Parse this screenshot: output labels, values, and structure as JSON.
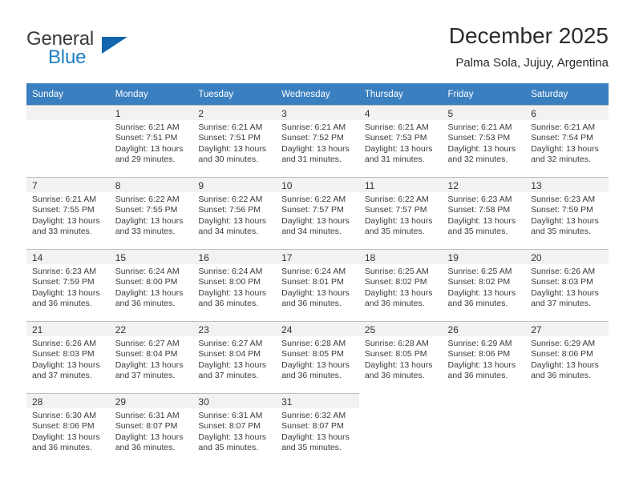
{
  "logo": {
    "word_one": "General",
    "word_two": "Blue",
    "triangle_icon": "triangle-icon",
    "color_blue": "#1d7fc4",
    "color_triangle": "#1266ad"
  },
  "header": {
    "title": "December 2025",
    "subtitle": "Palma Sola, Jujuy, Argentina"
  },
  "calendar": {
    "header_bg": "#3a7fbf",
    "daynum_bg": "#f2f2f2",
    "weekdays": [
      "Sunday",
      "Monday",
      "Tuesday",
      "Wednesday",
      "Thursday",
      "Friday",
      "Saturday"
    ],
    "weeks": [
      [
        {
          "day": "",
          "sunrise": "",
          "sunset": "",
          "daylight_line1": "",
          "daylight_line2": "",
          "empty": true
        },
        {
          "day": "1",
          "sunrise": "Sunrise: 6:21 AM",
          "sunset": "Sunset: 7:51 PM",
          "daylight_line1": "Daylight: 13 hours",
          "daylight_line2": "and 29 minutes."
        },
        {
          "day": "2",
          "sunrise": "Sunrise: 6:21 AM",
          "sunset": "Sunset: 7:51 PM",
          "daylight_line1": "Daylight: 13 hours",
          "daylight_line2": "and 30 minutes."
        },
        {
          "day": "3",
          "sunrise": "Sunrise: 6:21 AM",
          "sunset": "Sunset: 7:52 PM",
          "daylight_line1": "Daylight: 13 hours",
          "daylight_line2": "and 31 minutes."
        },
        {
          "day": "4",
          "sunrise": "Sunrise: 6:21 AM",
          "sunset": "Sunset: 7:53 PM",
          "daylight_line1": "Daylight: 13 hours",
          "daylight_line2": "and 31 minutes."
        },
        {
          "day": "5",
          "sunrise": "Sunrise: 6:21 AM",
          "sunset": "Sunset: 7:53 PM",
          "daylight_line1": "Daylight: 13 hours",
          "daylight_line2": "and 32 minutes."
        },
        {
          "day": "6",
          "sunrise": "Sunrise: 6:21 AM",
          "sunset": "Sunset: 7:54 PM",
          "daylight_line1": "Daylight: 13 hours",
          "daylight_line2": "and 32 minutes."
        }
      ],
      [
        {
          "day": "7",
          "sunrise": "Sunrise: 6:21 AM",
          "sunset": "Sunset: 7:55 PM",
          "daylight_line1": "Daylight: 13 hours",
          "daylight_line2": "and 33 minutes."
        },
        {
          "day": "8",
          "sunrise": "Sunrise: 6:22 AM",
          "sunset": "Sunset: 7:55 PM",
          "daylight_line1": "Daylight: 13 hours",
          "daylight_line2": "and 33 minutes."
        },
        {
          "day": "9",
          "sunrise": "Sunrise: 6:22 AM",
          "sunset": "Sunset: 7:56 PM",
          "daylight_line1": "Daylight: 13 hours",
          "daylight_line2": "and 34 minutes."
        },
        {
          "day": "10",
          "sunrise": "Sunrise: 6:22 AM",
          "sunset": "Sunset: 7:57 PM",
          "daylight_line1": "Daylight: 13 hours",
          "daylight_line2": "and 34 minutes."
        },
        {
          "day": "11",
          "sunrise": "Sunrise: 6:22 AM",
          "sunset": "Sunset: 7:57 PM",
          "daylight_line1": "Daylight: 13 hours",
          "daylight_line2": "and 35 minutes."
        },
        {
          "day": "12",
          "sunrise": "Sunrise: 6:23 AM",
          "sunset": "Sunset: 7:58 PM",
          "daylight_line1": "Daylight: 13 hours",
          "daylight_line2": "and 35 minutes."
        },
        {
          "day": "13",
          "sunrise": "Sunrise: 6:23 AM",
          "sunset": "Sunset: 7:59 PM",
          "daylight_line1": "Daylight: 13 hours",
          "daylight_line2": "and 35 minutes."
        }
      ],
      [
        {
          "day": "14",
          "sunrise": "Sunrise: 6:23 AM",
          "sunset": "Sunset: 7:59 PM",
          "daylight_line1": "Daylight: 13 hours",
          "daylight_line2": "and 36 minutes."
        },
        {
          "day": "15",
          "sunrise": "Sunrise: 6:24 AM",
          "sunset": "Sunset: 8:00 PM",
          "daylight_line1": "Daylight: 13 hours",
          "daylight_line2": "and 36 minutes."
        },
        {
          "day": "16",
          "sunrise": "Sunrise: 6:24 AM",
          "sunset": "Sunset: 8:00 PM",
          "daylight_line1": "Daylight: 13 hours",
          "daylight_line2": "and 36 minutes."
        },
        {
          "day": "17",
          "sunrise": "Sunrise: 6:24 AM",
          "sunset": "Sunset: 8:01 PM",
          "daylight_line1": "Daylight: 13 hours",
          "daylight_line2": "and 36 minutes."
        },
        {
          "day": "18",
          "sunrise": "Sunrise: 6:25 AM",
          "sunset": "Sunset: 8:02 PM",
          "daylight_line1": "Daylight: 13 hours",
          "daylight_line2": "and 36 minutes."
        },
        {
          "day": "19",
          "sunrise": "Sunrise: 6:25 AM",
          "sunset": "Sunset: 8:02 PM",
          "daylight_line1": "Daylight: 13 hours",
          "daylight_line2": "and 36 minutes."
        },
        {
          "day": "20",
          "sunrise": "Sunrise: 6:26 AM",
          "sunset": "Sunset: 8:03 PM",
          "daylight_line1": "Daylight: 13 hours",
          "daylight_line2": "and 37 minutes."
        }
      ],
      [
        {
          "day": "21",
          "sunrise": "Sunrise: 6:26 AM",
          "sunset": "Sunset: 8:03 PM",
          "daylight_line1": "Daylight: 13 hours",
          "daylight_line2": "and 37 minutes."
        },
        {
          "day": "22",
          "sunrise": "Sunrise: 6:27 AM",
          "sunset": "Sunset: 8:04 PM",
          "daylight_line1": "Daylight: 13 hours",
          "daylight_line2": "and 37 minutes."
        },
        {
          "day": "23",
          "sunrise": "Sunrise: 6:27 AM",
          "sunset": "Sunset: 8:04 PM",
          "daylight_line1": "Daylight: 13 hours",
          "daylight_line2": "and 37 minutes."
        },
        {
          "day": "24",
          "sunrise": "Sunrise: 6:28 AM",
          "sunset": "Sunset: 8:05 PM",
          "daylight_line1": "Daylight: 13 hours",
          "daylight_line2": "and 36 minutes."
        },
        {
          "day": "25",
          "sunrise": "Sunrise: 6:28 AM",
          "sunset": "Sunset: 8:05 PM",
          "daylight_line1": "Daylight: 13 hours",
          "daylight_line2": "and 36 minutes."
        },
        {
          "day": "26",
          "sunrise": "Sunrise: 6:29 AM",
          "sunset": "Sunset: 8:06 PM",
          "daylight_line1": "Daylight: 13 hours",
          "daylight_line2": "and 36 minutes."
        },
        {
          "day": "27",
          "sunrise": "Sunrise: 6:29 AM",
          "sunset": "Sunset: 8:06 PM",
          "daylight_line1": "Daylight: 13 hours",
          "daylight_line2": "and 36 minutes."
        }
      ],
      [
        {
          "day": "28",
          "sunrise": "Sunrise: 6:30 AM",
          "sunset": "Sunset: 8:06 PM",
          "daylight_line1": "Daylight: 13 hours",
          "daylight_line2": "and 36 minutes."
        },
        {
          "day": "29",
          "sunrise": "Sunrise: 6:31 AM",
          "sunset": "Sunset: 8:07 PM",
          "daylight_line1": "Daylight: 13 hours",
          "daylight_line2": "and 36 minutes."
        },
        {
          "day": "30",
          "sunrise": "Sunrise: 6:31 AM",
          "sunset": "Sunset: 8:07 PM",
          "daylight_line1": "Daylight: 13 hours",
          "daylight_line2": "and 35 minutes."
        },
        {
          "day": "31",
          "sunrise": "Sunrise: 6:32 AM",
          "sunset": "Sunset: 8:07 PM",
          "daylight_line1": "Daylight: 13 hours",
          "daylight_line2": "and 35 minutes."
        },
        {
          "day": "",
          "sunrise": "",
          "sunset": "",
          "daylight_line1": "",
          "daylight_line2": "",
          "blank": true
        },
        {
          "day": "",
          "sunrise": "",
          "sunset": "",
          "daylight_line1": "",
          "daylight_line2": "",
          "blank": true
        },
        {
          "day": "",
          "sunrise": "",
          "sunset": "",
          "daylight_line1": "",
          "daylight_line2": "",
          "blank": true
        }
      ]
    ]
  }
}
